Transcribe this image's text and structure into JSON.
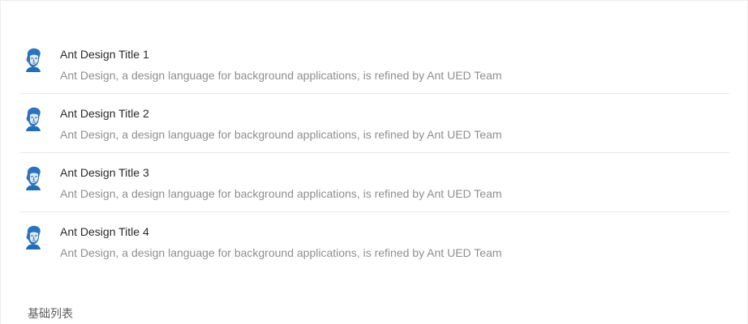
{
  "list": {
    "items": [
      {
        "title": "Ant Design Title 1",
        "description": "Ant Design, a design language for background applications, is refined by Ant UED Team",
        "avatar_icon": "user-portrait-icon"
      },
      {
        "title": "Ant Design Title 2",
        "description": "Ant Design, a design language for background applications, is refined by Ant UED Team",
        "avatar_icon": "user-portrait-icon"
      },
      {
        "title": "Ant Design Title 3",
        "description": "Ant Design, a design language for background applications, is refined by Ant UED Team",
        "avatar_icon": "user-portrait-icon"
      },
      {
        "title": "Ant Design Title 4",
        "description": "Ant Design, a design language for background applications, is refined by Ant UED Team",
        "avatar_icon": "user-portrait-icon"
      }
    ]
  },
  "footer": {
    "caption": "基础列表"
  },
  "colors": {
    "title": "#262626",
    "description": "#8c8c8c",
    "divider": "#e8e8e8",
    "avatar_blue": "#1f6fb8"
  }
}
